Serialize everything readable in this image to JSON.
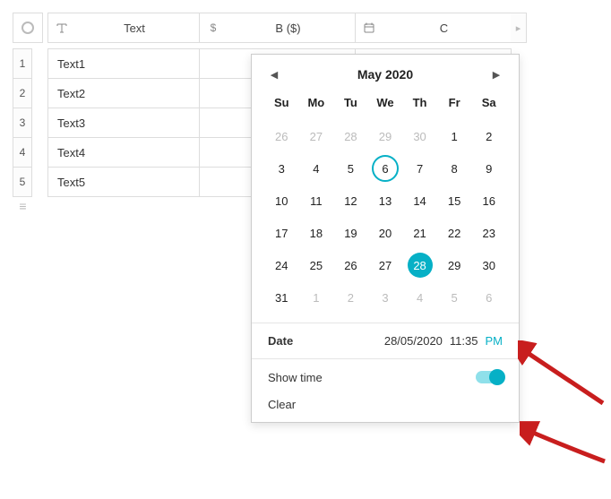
{
  "sheet": {
    "columns": [
      {
        "icon": "text-icon",
        "glyph": "T",
        "label": "Text"
      },
      {
        "icon": "currency-icon",
        "glyph": "$",
        "label": "B ($)"
      },
      {
        "icon": "date-icon",
        "glyph": "▭",
        "label": "C"
      }
    ],
    "rows": [
      {
        "num": "1",
        "text": "Text1"
      },
      {
        "num": "2",
        "text": "Text2"
      },
      {
        "num": "3",
        "text": "Text3"
      },
      {
        "num": "4",
        "text": "Text4"
      },
      {
        "num": "5",
        "text": "Text5"
      }
    ]
  },
  "datepicker": {
    "title": "May 2020",
    "weekdays": [
      "Su",
      "Mo",
      "Tu",
      "We",
      "Th",
      "Fr",
      "Sa"
    ],
    "cells": [
      {
        "d": "26",
        "other": true
      },
      {
        "d": "27",
        "other": true
      },
      {
        "d": "28",
        "other": true
      },
      {
        "d": "29",
        "other": true
      },
      {
        "d": "30",
        "other": true
      },
      {
        "d": "1"
      },
      {
        "d": "2"
      },
      {
        "d": "3"
      },
      {
        "d": "4"
      },
      {
        "d": "5"
      },
      {
        "d": "6",
        "today": true
      },
      {
        "d": "7"
      },
      {
        "d": "8"
      },
      {
        "d": "9"
      },
      {
        "d": "10"
      },
      {
        "d": "11"
      },
      {
        "d": "12"
      },
      {
        "d": "13"
      },
      {
        "d": "14"
      },
      {
        "d": "15"
      },
      {
        "d": "16"
      },
      {
        "d": "17"
      },
      {
        "d": "18"
      },
      {
        "d": "19"
      },
      {
        "d": "20"
      },
      {
        "d": "21"
      },
      {
        "d": "22"
      },
      {
        "d": "23"
      },
      {
        "d": "24"
      },
      {
        "d": "25"
      },
      {
        "d": "26"
      },
      {
        "d": "27"
      },
      {
        "d": "28",
        "selected": true
      },
      {
        "d": "29"
      },
      {
        "d": "30"
      },
      {
        "d": "31"
      },
      {
        "d": "1",
        "other": true
      },
      {
        "d": "2",
        "other": true
      },
      {
        "d": "3",
        "other": true
      },
      {
        "d": "4",
        "other": true
      },
      {
        "d": "5",
        "other": true
      },
      {
        "d": "6",
        "other": true
      }
    ],
    "date_label": "Date",
    "date_value": "28/05/2020",
    "time_value": "11:35",
    "ampm": "PM",
    "show_time_label": "Show time",
    "clear_label": "Clear"
  }
}
